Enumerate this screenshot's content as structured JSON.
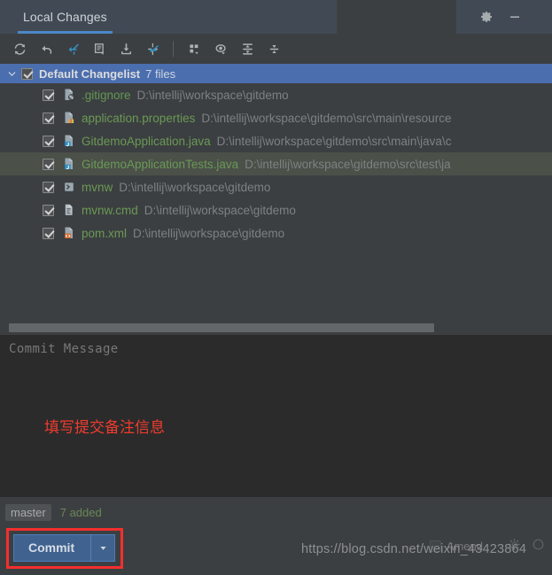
{
  "window": {
    "tabs": [
      {
        "label": "Local Changes",
        "active": true
      }
    ],
    "gear_icon": "gear-icon",
    "minimize_icon": "minimize-icon"
  },
  "toolbar": {
    "buttons": [
      {
        "name": "refresh-button",
        "icon": "refresh-icon",
        "tooltip": "Refresh"
      },
      {
        "name": "rollback-button",
        "icon": "rollback-icon",
        "tooltip": "Rollback"
      },
      {
        "name": "shelve-button",
        "icon": "shelve-silently-icon",
        "tooltip": "Shelve Silently"
      },
      {
        "name": "show-diff-button",
        "icon": "diff-icon",
        "tooltip": "Show Diff"
      },
      {
        "name": "update-button",
        "icon": "update-project-icon",
        "tooltip": "Update Project"
      },
      {
        "name": "move-to-changelist-button",
        "icon": "move-to-changelist-icon",
        "tooltip": "Move to Another Changelist"
      },
      {
        "name": "group-by-button",
        "icon": "group-by-icon",
        "tooltip": "Group By"
      },
      {
        "name": "preview-button",
        "icon": "preview-diff-icon",
        "tooltip": "Preview Diff"
      },
      {
        "name": "expand-all-button",
        "icon": "expand-all-icon",
        "tooltip": "Expand All"
      },
      {
        "name": "collapse-all-button",
        "icon": "collapse-all-icon",
        "tooltip": "Collapse All"
      }
    ]
  },
  "changelist": {
    "expanded": true,
    "checked": true,
    "name": "Default Changelist",
    "count_label": "7 files",
    "highlight_color": "#4b6eaf"
  },
  "files": [
    {
      "checked": true,
      "icon": "gitignore-file-icon",
      "name": ".gitignore",
      "name_color": "#629755",
      "path": "D:\\intellij\\workspace\\gitdemo",
      "selected": false
    },
    {
      "checked": true,
      "icon": "properties-file-icon",
      "name": "application.properties",
      "name_color": "#6a9955",
      "path": "D:\\intellij\\workspace\\gitdemo\\src\\main\\resource",
      "selected": false
    },
    {
      "checked": true,
      "icon": "java-file-icon",
      "name": "GitdemoApplication.java",
      "name_color": "#6a9955",
      "path": "D:\\intellij\\workspace\\gitdemo\\src\\main\\java\\c",
      "selected": false
    },
    {
      "checked": true,
      "icon": "java-test-file-icon",
      "name": "GitdemoApplicationTests.java",
      "name_color": "#6a9955",
      "path": "D:\\intellij\\workspace\\gitdemo\\src\\test\\ja",
      "selected": true
    },
    {
      "checked": true,
      "icon": "shell-script-file-icon",
      "name": "mvnw",
      "name_color": "#6a9955",
      "path": "D:\\intellij\\workspace\\gitdemo",
      "selected": false
    },
    {
      "checked": true,
      "icon": "cmd-file-icon",
      "name": "mvnw.cmd",
      "name_color": "#6a9955",
      "path": "D:\\intellij\\workspace\\gitdemo",
      "selected": false
    },
    {
      "checked": true,
      "icon": "xml-file-icon",
      "name": "pom.xml",
      "name_color": "#6a9955",
      "path": "D:\\intellij\\workspace\\gitdemo",
      "selected": false
    }
  ],
  "commit_message": {
    "placeholder": "Commit Message",
    "value": "",
    "annotation": "填写提交备注信息",
    "annotation_color": "#f03c2e"
  },
  "status": {
    "branch": "master",
    "added_label": "7 added",
    "added_color": "#6a8759"
  },
  "actions": {
    "commit_label": "Commit",
    "commit_dropdown_icon": "chevron-down-icon",
    "commit_color": "#40628f",
    "highlight_border_color": "#f42f2f",
    "amend_label": "Amend",
    "amend_checked": false,
    "settings_icon": "gear-icon",
    "help_icon": "help-circle-icon"
  },
  "watermark": {
    "text": "https://blog.csdn.net/weixin_43423864"
  }
}
